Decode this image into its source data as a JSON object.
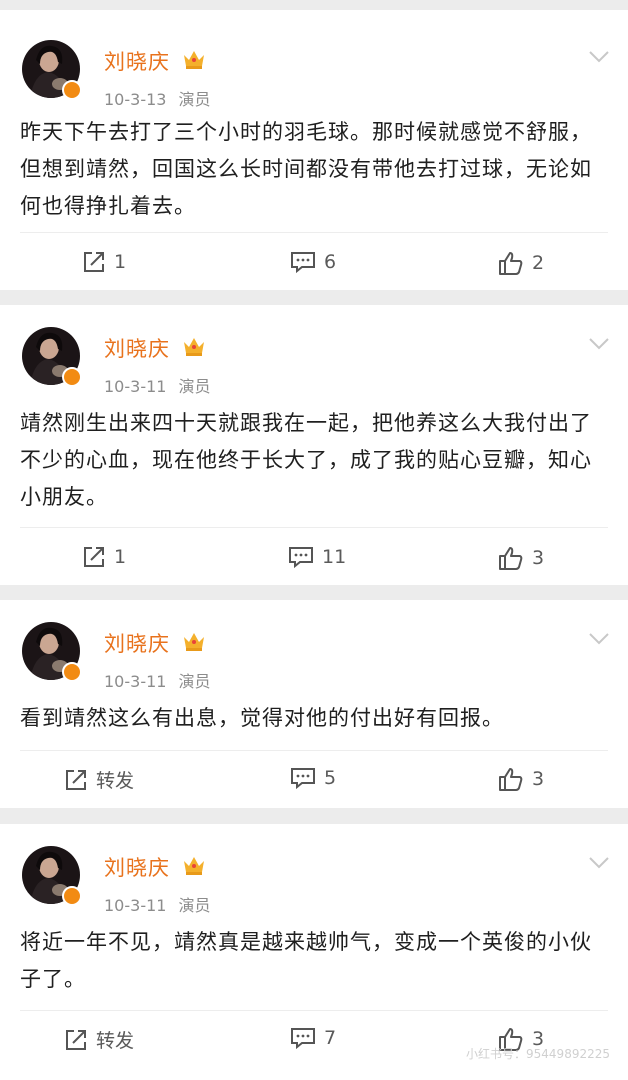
{
  "posts": [
    {
      "user": "刘晓庆",
      "date": "10-3-13",
      "source": "演员",
      "text": "昨天下午去打了三个小时的羽毛球。那时候就感觉不舒服，但想到靖然，回国这么长时间都没有带他去打过球，无论如何也得挣扎着去。",
      "repost": "1",
      "comments": "6",
      "likes": "2"
    },
    {
      "user": "刘晓庆",
      "date": "10-3-11",
      "source": "演员",
      "text": "靖然刚生出来四十天就跟我在一起，把他养这么大我付出了不少的心血，现在他终于长大了，成了我的贴心豆瓣，知心小朋友。",
      "repost": "1",
      "comments": "11",
      "likes": "3"
    },
    {
      "user": "刘晓庆",
      "date": "10-3-11",
      "source": "演员",
      "text": "看到靖然这么有出息，觉得对他的付出好有回报。",
      "repost": "转发",
      "comments": "5",
      "likes": "3"
    },
    {
      "user": "刘晓庆",
      "date": "10-3-11",
      "source": "演员",
      "text": "将近一年不见，靖然真是越来越帅气，变成一个英俊的小伙子了。",
      "repost": "转发",
      "comments": "7",
      "likes": "3"
    }
  ],
  "watermark": "小红书号：95449892225",
  "icons": {
    "avatar": "avatar-photo",
    "badge": "verified-badge-icon",
    "crown": "crown-icon",
    "menu": "chevron-down-icon",
    "repost": "repost-icon",
    "comment": "comment-icon",
    "like": "thumbs-up-icon"
  },
  "colors": {
    "name": "#e8721c",
    "badge": "#f28b13",
    "text": "#1f1f1f",
    "meta": "#8c8c8c"
  }
}
